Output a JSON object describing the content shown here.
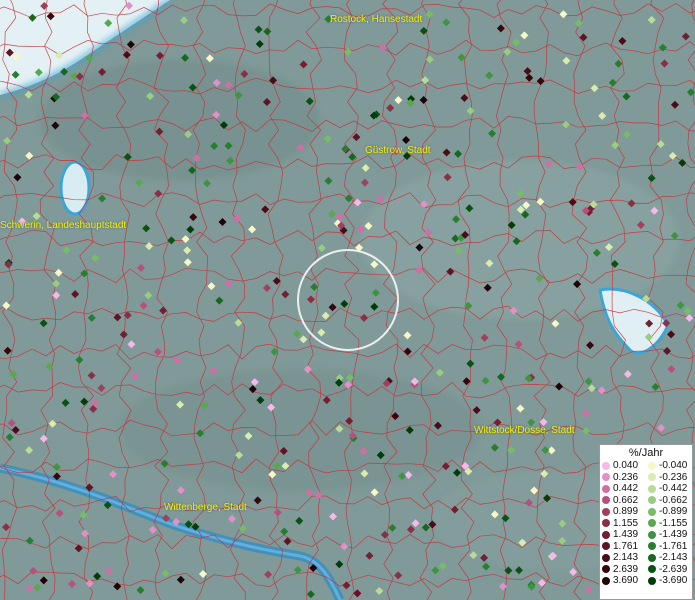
{
  "places": [
    {
      "name": "Rostock, Hansestadt"
    },
    {
      "name": "Güstrow, Stadt"
    },
    {
      "name": "Schwerin, Landeshauptstadt"
    },
    {
      "name": "Wittstock/Dosse, Stadt"
    },
    {
      "name": "Wittenberge, Stadt"
    }
  ],
  "legend": {
    "title": "%/Jahr",
    "positive": [
      "0.040",
      "0.236",
      "0.442",
      "0.662",
      "0.899",
      "1.155",
      "1.439",
      "1.761",
      "2.143",
      "2.639",
      "3.690"
    ],
    "negative": [
      "-0.040",
      "-0.236",
      "-0.442",
      "-0.662",
      "-0.899",
      "-1.155",
      "-1.439",
      "-1.761",
      "-2.143",
      "-2.639",
      "-3.690"
    ],
    "positive_colors": [
      "#f5b8e8",
      "#e490c8",
      "#d06fa6",
      "#b8507e",
      "#a0405e",
      "#8a2f46",
      "#741f32",
      "#5e1422",
      "#4a0c16",
      "#36060c",
      "#1e0206"
    ],
    "negative_colors": [
      "#f6f8c8",
      "#d8ecb0",
      "#b8dc98",
      "#98cc80",
      "#78bc68",
      "#58a850",
      "#3e9440",
      "#287e30",
      "#166820",
      "#0a5214",
      "#023c08"
    ]
  }
}
